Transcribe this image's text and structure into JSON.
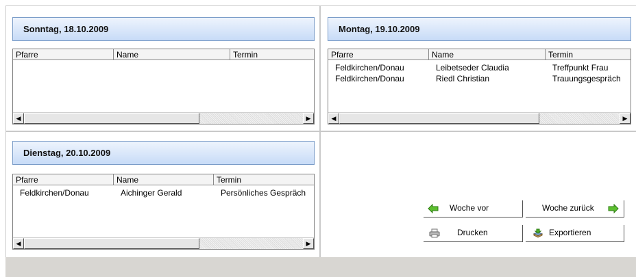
{
  "columns": [
    "Pfarre",
    "Name",
    "Termin"
  ],
  "panels": [
    {
      "title": "Sonntag, 18.10.2009",
      "rows": []
    },
    {
      "title": "Montag, 19.10.2009",
      "rows": [
        [
          "Feldkirchen/Donau",
          "Leibetseder Claudia",
          "Treffpunkt Frau"
        ],
        [
          "Feldkirchen/Donau",
          "Riedl Christian",
          "Trauungsgespräch"
        ]
      ]
    },
    {
      "title": "Dienstag, 20.10.2009",
      "rows": [
        [
          "Feldkirchen/Donau",
          "Aichinger Gerald",
          "Persönliches Gespräch"
        ]
      ]
    }
  ],
  "buttons": {
    "week_forward": "Woche vor",
    "week_back": "Woche zurück",
    "print": "Drucken",
    "export": "Exportieren"
  },
  "icons": {
    "week_forward": "arrow-left-icon",
    "week_back": "arrow-right-icon",
    "print": "printer-icon",
    "export": "export-icon"
  },
  "colors": {
    "header_top": "#eef4fd",
    "header_bottom": "#c7dbf7",
    "arrow_green": "#4caf2a"
  }
}
